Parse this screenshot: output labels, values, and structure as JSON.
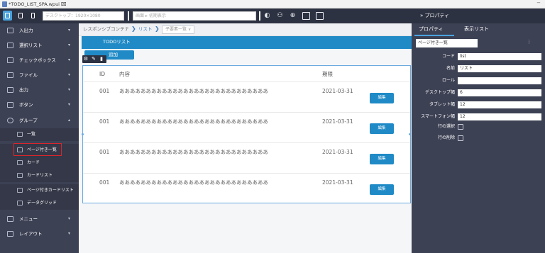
{
  "window": {
    "tab_title": "*TODO_LIST_SPA.wpui ⌧",
    "minimize": "−"
  },
  "toolbar": {
    "device_placeholder": "デスクトップ：1920×1080",
    "breadcrumb_placeholder": "画面 ▸ 初期表示"
  },
  "right_header": {
    "title": "» プロパティ"
  },
  "sidebar": {
    "items": [
      {
        "label": "入出力",
        "chevron": "▾"
      },
      {
        "label": "選択リスト",
        "chevron": "▾"
      },
      {
        "label": "チェックボックス",
        "chevron": "▾"
      },
      {
        "label": "ファイル",
        "chevron": "▾"
      },
      {
        "label": "出力",
        "chevron": "▾"
      },
      {
        "label": "ボタン",
        "chevron": "▾"
      },
      {
        "label": "グループ",
        "chevron": "▴"
      },
      {
        "label": "メニュー",
        "chevron": "▾"
      },
      {
        "label": "レイアウト",
        "chevron": "▾"
      }
    ],
    "sub_items": [
      {
        "label": "一覧"
      },
      {
        "label": "ページ付き一覧"
      },
      {
        "label": "カード"
      },
      {
        "label": "カードリスト"
      },
      {
        "label": "ページ付きカードリスト"
      },
      {
        "label": "データグリッド"
      }
    ]
  },
  "breadcrumb": {
    "container": "レスポンシブコンテナ",
    "list": "リスト",
    "child": "子要素一覧 ∨",
    "arrow": "❯"
  },
  "list": {
    "title": "TODOリスト",
    "add_label": "追加",
    "columns": [
      "ID",
      "内容",
      "期限"
    ],
    "rows": [
      {
        "id": "001",
        "content": "ああああああああああああああああああああああああああああ",
        "due": "2021-03-31",
        "edit": "編集"
      },
      {
        "id": "001",
        "content": "ああああああああああああああああああああああああああああ",
        "due": "2021-03-31",
        "edit": "編集"
      },
      {
        "id": "001",
        "content": "ああああああああああああああああああああああああああああ",
        "due": "2021-03-31",
        "edit": "編集"
      },
      {
        "id": "001",
        "content": "ああああああああああああああああああああああああああああ",
        "due": "2021-03-31",
        "edit": "編集"
      }
    ]
  },
  "properties": {
    "tabs": [
      "プロパティ",
      "表示リスト"
    ],
    "component": "ページ付き一覧",
    "menu": "⋮",
    "fields": [
      {
        "label": "コード",
        "value": "list"
      },
      {
        "label": "名前",
        "value": "リスト"
      },
      {
        "label": "ロール",
        "value": ""
      },
      {
        "label": "デスクトップ幅",
        "value": "6"
      },
      {
        "label": "タブレット幅",
        "value": "12"
      },
      {
        "label": "スマートフォン幅",
        "value": "12"
      }
    ],
    "checks": [
      {
        "label": "行の選択",
        "checked": false
      },
      {
        "label": "行の削除",
        "checked": false
      }
    ]
  },
  "colors": {
    "accent": "#1f8ac6",
    "sidebar": "#3d4154",
    "toolbar": "#2d3242",
    "highlight": "#d9252c"
  }
}
